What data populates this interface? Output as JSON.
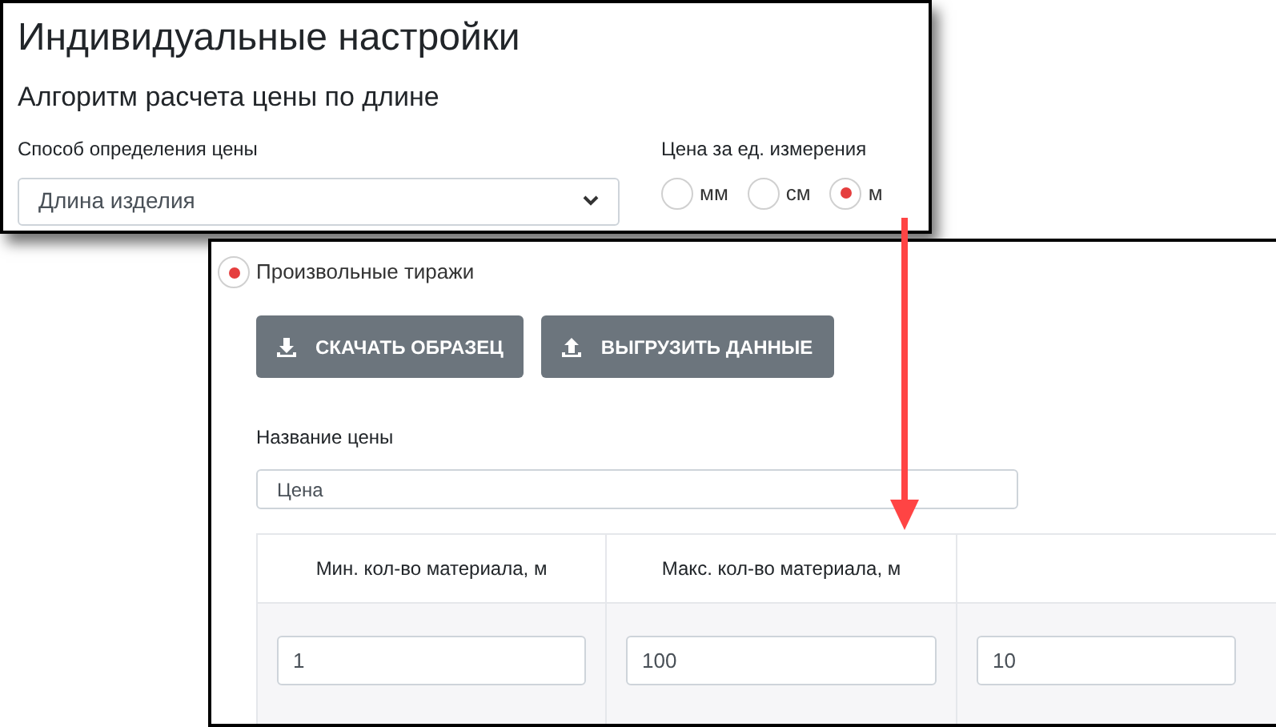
{
  "settings_panel": {
    "title": "Индивидуальные настройки",
    "subtitle": "Алгоритм расчета цены по длине",
    "price_method": {
      "label": "Способ определения цены",
      "value": "Длина изделия"
    },
    "unit": {
      "label": "Цена за ед. измерения",
      "options": [
        {
          "label": "мм",
          "selected": false
        },
        {
          "label": "см",
          "selected": false
        },
        {
          "label": "м",
          "selected": true
        }
      ]
    }
  },
  "runs_panel": {
    "custom_runs": {
      "label": "Произвольные тиражи",
      "selected": true
    },
    "buttons": [
      {
        "label": "СКАЧАТЬ ОБРАЗЕЦ",
        "kind": "download"
      },
      {
        "label": "ВЫГРУЗИТЬ ДАННЫЕ",
        "kind": "upload"
      }
    ],
    "price_name": {
      "label": "Название цены",
      "value": "Цена"
    },
    "table": {
      "columns": [
        "Мин. кол-во материала, м",
        "Макс. кол-во материала, м"
      ],
      "rows": [
        [
          "1",
          "100",
          "10"
        ]
      ]
    }
  }
}
